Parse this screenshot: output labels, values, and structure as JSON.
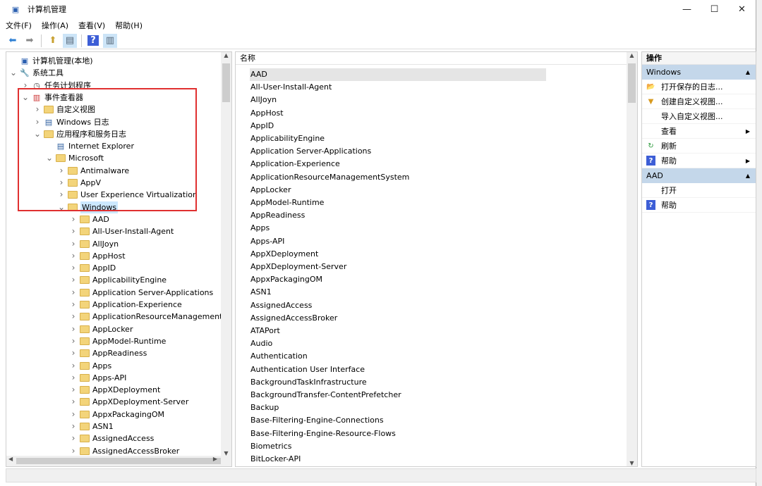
{
  "window": {
    "title": "计算机管理",
    "controls": [
      "minimize",
      "maximize",
      "close"
    ]
  },
  "menu": [
    "文件(F)",
    "操作(A)",
    "查看(V)",
    "帮助(H)"
  ],
  "toolbar": [
    "back-icon",
    "forward-icon",
    "up-icon",
    "show-hide-console-tree-icon",
    "help-icon",
    "show-hide-action-pane-icon"
  ],
  "tree": [
    {
      "label": "计算机管理(本地)",
      "level": 0,
      "chev": "",
      "icon": "computer-icon"
    },
    {
      "label": "系统工具",
      "level": 0,
      "chev": "v",
      "icon": "tools-icon"
    },
    {
      "label": "任务计划程序",
      "level": 1,
      "chev": ">",
      "icon": "clock-icon"
    },
    {
      "label": "事件查看器",
      "level": 1,
      "chev": "v",
      "icon": "event-viewer-icon"
    },
    {
      "label": "自定义视图",
      "level": 2,
      "chev": ">",
      "icon": "folder-icon"
    },
    {
      "label": "Windows 日志",
      "level": 2,
      "chev": ">",
      "icon": "log-icon"
    },
    {
      "label": "应用程序和服务日志",
      "level": 2,
      "chev": "v",
      "icon": "folder-icon"
    },
    {
      "label": "Internet Explorer",
      "level": 3,
      "chev": "",
      "icon": "log-icon"
    },
    {
      "label": "Microsoft",
      "level": 3,
      "chev": "v",
      "icon": "folder-icon"
    },
    {
      "label": "Antimalware",
      "level": 4,
      "chev": ">",
      "icon": "folder-icon"
    },
    {
      "label": "AppV",
      "level": 4,
      "chev": ">",
      "icon": "folder-icon"
    },
    {
      "label": "User Experience Virtualization",
      "level": 4,
      "chev": ">",
      "icon": "folder-icon"
    },
    {
      "label": "Windows",
      "level": 4,
      "chev": "v",
      "icon": "folder-icon",
      "selected": true
    },
    {
      "label": "AAD",
      "level": 5,
      "chev": ">",
      "icon": "folder-icon"
    },
    {
      "label": "All-User-Install-Agent",
      "level": 5,
      "chev": ">",
      "icon": "folder-icon"
    },
    {
      "label": "AllJoyn",
      "level": 5,
      "chev": ">",
      "icon": "folder-icon"
    },
    {
      "label": "AppHost",
      "level": 5,
      "chev": ">",
      "icon": "folder-icon"
    },
    {
      "label": "AppID",
      "level": 5,
      "chev": ">",
      "icon": "folder-icon"
    },
    {
      "label": "ApplicabilityEngine",
      "level": 5,
      "chev": ">",
      "icon": "folder-icon"
    },
    {
      "label": "Application Server-Applications",
      "level": 5,
      "chev": ">",
      "icon": "folder-icon"
    },
    {
      "label": "Application-Experience",
      "level": 5,
      "chev": ">",
      "icon": "folder-icon"
    },
    {
      "label": "ApplicationResourceManagementSys",
      "level": 5,
      "chev": ">",
      "icon": "folder-icon"
    },
    {
      "label": "AppLocker",
      "level": 5,
      "chev": ">",
      "icon": "folder-icon"
    },
    {
      "label": "AppModel-Runtime",
      "level": 5,
      "chev": ">",
      "icon": "folder-icon"
    },
    {
      "label": "AppReadiness",
      "level": 5,
      "chev": ">",
      "icon": "folder-icon"
    },
    {
      "label": "Apps",
      "level": 5,
      "chev": ">",
      "icon": "folder-icon"
    },
    {
      "label": "Apps-API",
      "level": 5,
      "chev": ">",
      "icon": "folder-icon"
    },
    {
      "label": "AppXDeployment",
      "level": 5,
      "chev": ">",
      "icon": "folder-icon"
    },
    {
      "label": "AppXDeployment-Server",
      "level": 5,
      "chev": ">",
      "icon": "folder-icon"
    },
    {
      "label": "AppxPackagingOM",
      "level": 5,
      "chev": ">",
      "icon": "folder-icon"
    },
    {
      "label": "ASN1",
      "level": 5,
      "chev": ">",
      "icon": "folder-icon"
    },
    {
      "label": "AssignedAccess",
      "level": 5,
      "chev": ">",
      "icon": "folder-icon"
    },
    {
      "label": "AssignedAccessBroker",
      "level": 5,
      "chev": ">",
      "icon": "folder-icon"
    }
  ],
  "list": {
    "header": "名称",
    "items": [
      "AAD",
      "All-User-Install-Agent",
      "AllJoyn",
      "AppHost",
      "AppID",
      "ApplicabilityEngine",
      "Application Server-Applications",
      "Application-Experience",
      "ApplicationResourceManagementSystem",
      "AppLocker",
      "AppModel-Runtime",
      "AppReadiness",
      "Apps",
      "Apps-API",
      "AppXDeployment",
      "AppXDeployment-Server",
      "AppxPackagingOM",
      "ASN1",
      "AssignedAccess",
      "AssignedAccessBroker",
      "ATAPort",
      "Audio",
      "Authentication",
      "Authentication User Interface",
      "BackgroundTaskInfrastructure",
      "BackgroundTransfer-ContentPrefetcher",
      "Backup",
      "Base-Filtering-Engine-Connections",
      "Base-Filtering-Engine-Resource-Flows",
      "Biometrics",
      "BitLocker-API"
    ]
  },
  "actions": {
    "header": "操作",
    "sections": [
      {
        "title": "Windows",
        "items": [
          {
            "label": "打开保存的日志...",
            "icon": "open-log-icon"
          },
          {
            "label": "创建自定义视图...",
            "icon": "filter-icon"
          },
          {
            "label": "导入自定义视图...",
            "icon": ""
          },
          {
            "label": "查看",
            "icon": "",
            "submenu": true
          },
          {
            "label": "刷新",
            "icon": "refresh-icon"
          },
          {
            "label": "帮助",
            "icon": "help-icon",
            "submenu": true
          }
        ]
      },
      {
        "title": "AAD",
        "items": [
          {
            "label": "打开",
            "icon": ""
          },
          {
            "label": "帮助",
            "icon": "help-icon"
          }
        ]
      }
    ]
  }
}
